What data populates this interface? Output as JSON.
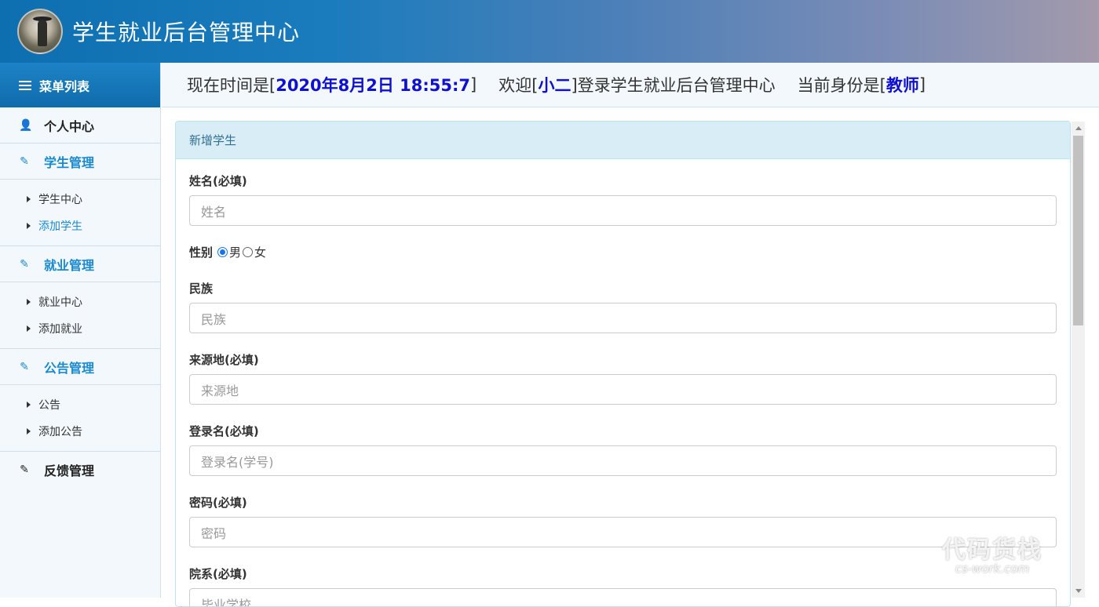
{
  "header": {
    "title": "学生就业后台管理中心"
  },
  "sidebar": {
    "menu_title": "菜单列表",
    "personal": "个人中心",
    "groups": [
      {
        "label": "学生管理",
        "items": [
          "学生中心",
          "添加学生"
        ]
      },
      {
        "label": "就业管理",
        "items": [
          "就业中心",
          "添加就业"
        ]
      },
      {
        "label": "公告管理",
        "items": [
          "公告",
          "添加公告"
        ]
      },
      {
        "label": "反馈管理"
      }
    ]
  },
  "infobar": {
    "time_prefix": "现在时间是[",
    "time_value": "2020年8月2日 18:55:7",
    "time_suffix": "]",
    "welcome_prefix": "欢迎[",
    "user_name": "小二",
    "welcome_suffix": "]登录学生就业后台管理中心",
    "role_prefix": "当前身份是[",
    "role_value": "教师",
    "role_suffix": "]"
  },
  "form": {
    "panel_title": "新增学生",
    "name_label": "姓名(必填)",
    "name_placeholder": "姓名",
    "gender_label": "性别",
    "gender_male": "男",
    "gender_female": "女",
    "gender_selected": "男",
    "ethnicity_label": "民族",
    "ethnicity_placeholder": "民族",
    "origin_label": "来源地(必填)",
    "origin_placeholder": "来源地",
    "login_label": "登录名(必填)",
    "login_placeholder": "登录名(学号)",
    "password_label": "密码(必填)",
    "password_placeholder": "密码",
    "dept_label": "院系(必填)",
    "dept_placeholder": "毕业学校"
  },
  "watermark": {
    "line1": "代码货栈",
    "line2": "cs-work.com"
  },
  "colors": {
    "accent": "#1a8ad0",
    "highlight": "#1010d0",
    "panel_head": "#d9edf7"
  }
}
